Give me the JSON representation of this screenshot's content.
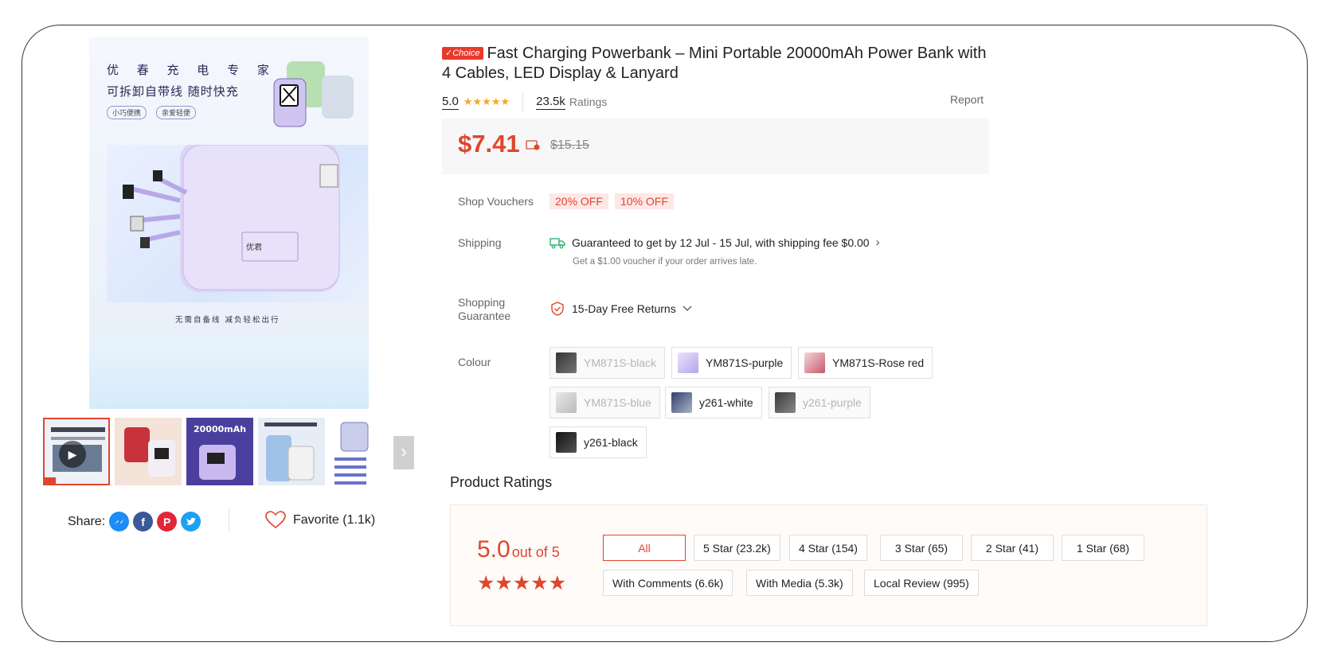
{
  "gallery": {
    "main_title_cn": "优 春 充 电 专 家",
    "main_sub_cn": "可拆卸自带线 随时快充",
    "tag1": "小巧便携",
    "tag2": "亲爱轻便",
    "caption_cn": "无需自备线 减负轻松出行",
    "thumb3_text": "20000mAh"
  },
  "share": {
    "label": "Share:"
  },
  "favorite": {
    "label": "Favorite (1.1k)"
  },
  "product": {
    "badge": "✓Choice",
    "title": "Fast Charging Powerbank – Mini Portable 20000mAh Power Bank with 4 Cables, LED Display & Lanyard",
    "rating": "5.0",
    "rating_count": "23.5k",
    "ratings_label": "Ratings",
    "report": "Report",
    "price": "$7.41",
    "original_price": "$15.15"
  },
  "vouchers": {
    "label": "Shop Vouchers",
    "items": [
      "20% OFF",
      "10% OFF"
    ]
  },
  "shipping": {
    "label": "Shipping",
    "text": "Guaranteed to get by 12 Jul - 15 Jul, with shipping fee $0.00",
    "sub": "Get a $1.00 voucher if your order arrives late."
  },
  "guarantee": {
    "label_line1": "Shopping",
    "label_line2": "Guarantee",
    "text": "15-Day Free Returns"
  },
  "colour": {
    "label": "Colour",
    "options": [
      {
        "name": "YM871S-black",
        "disabled": true
      },
      {
        "name": "YM871S-purple",
        "disabled": false
      },
      {
        "name": "YM871S-Rose red",
        "disabled": false
      },
      {
        "name": "YM871S-blue",
        "disabled": true
      },
      {
        "name": "y261-white",
        "disabled": false
      },
      {
        "name": "y261-purple",
        "disabled": true
      },
      {
        "name": "y261-black",
        "disabled": false
      }
    ]
  },
  "ratings": {
    "heading": "Product Ratings",
    "score": "5.0",
    "out_of": "out of 5",
    "filters": [
      "All",
      "5 Star (23.2k)",
      "4 Star (154)",
      "3 Star (65)",
      "2 Star (41)",
      "1 Star (68)",
      "With Comments (6.6k)",
      "With Media (5.3k)",
      "Local Review (995)"
    ],
    "active_filter": "All"
  },
  "colors": {
    "accent": "#e0452e",
    "star": "#f6a623",
    "price_bg": "#f7f7f7",
    "voucher_bg": "#fde8e6"
  }
}
